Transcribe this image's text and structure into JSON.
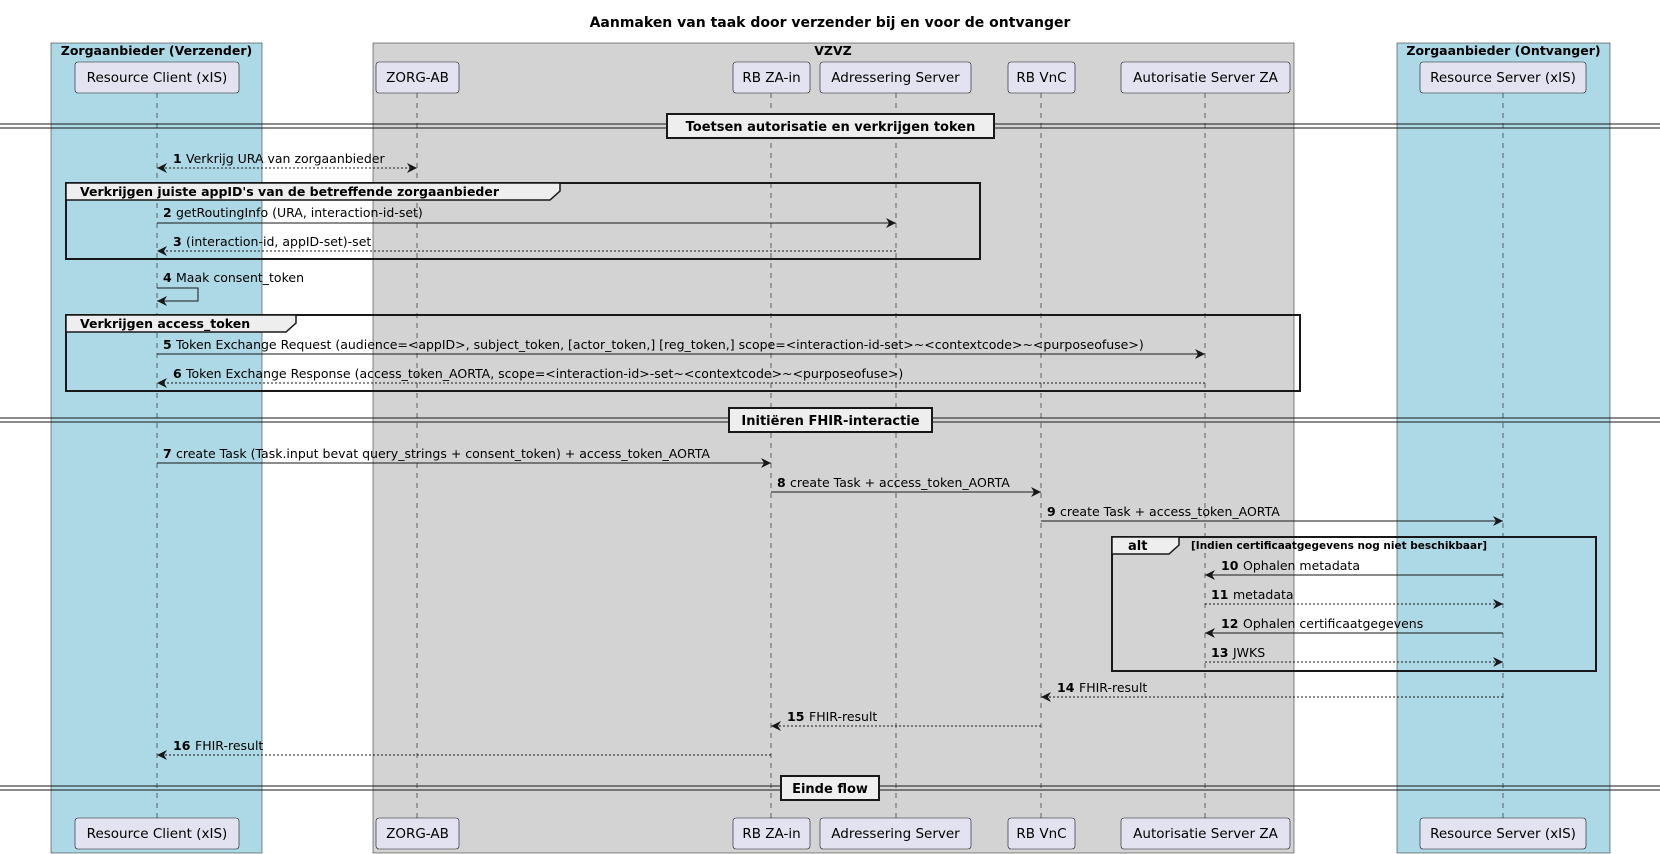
{
  "title": "Aanmaken van taak door verzender bij en voor de ontvanger",
  "boxes": [
    {
      "id": "verzender",
      "title": "Zorgaanbieder (Verzender)",
      "color": "#add8e6"
    },
    {
      "id": "vzvz",
      "title": "VZVZ",
      "color": "#d3d3d3"
    },
    {
      "id": "ontvanger",
      "title": "Zorgaanbieder (Ontvanger)",
      "color": "#add8e6"
    }
  ],
  "participants": [
    {
      "id": "rc",
      "label": "Resource Client (xIS)"
    },
    {
      "id": "zorgab",
      "label": "ZORG-AB"
    },
    {
      "id": "rbza",
      "label": "RB ZA-in"
    },
    {
      "id": "adr",
      "label": "Adressering Server"
    },
    {
      "id": "rbvnc",
      "label": "RB VnC"
    },
    {
      "id": "auth",
      "label": "Autorisatie Server ZA"
    },
    {
      "id": "rs",
      "label": "Resource Server (xIS)"
    }
  ],
  "dividers": [
    {
      "id": "d1",
      "label": "Toetsen autorisatie en verkrijgen token"
    },
    {
      "id": "d2",
      "label": "Initiëren FHIR-interactie"
    },
    {
      "id": "d3",
      "label": "Einde flow"
    }
  ],
  "groups": [
    {
      "id": "g1",
      "label": "Verkrijgen juiste appID's van de betreffende zorgaanbieder"
    },
    {
      "id": "g2",
      "label": "Verkrijgen access_token"
    },
    {
      "id": "g3",
      "keyword": "alt",
      "label": "[Indien certificaatgegevens nog niet beschikbaar]"
    }
  ],
  "messages": [
    {
      "num": "1",
      "from": "rc",
      "to": "zorgab",
      "label": "Verkrijg URA van zorgaanbieder",
      "style": "bidir-dashed"
    },
    {
      "num": "2",
      "from": "rc",
      "to": "adr",
      "label": "getRoutingInfo (URA, interaction-id-set)",
      "style": "solid"
    },
    {
      "num": "3",
      "from": "adr",
      "to": "rc",
      "label": "(interaction-id, appID-set)-set",
      "style": "dashed"
    },
    {
      "num": "4",
      "from": "rc",
      "to": "rc",
      "label": "Maak consent_token",
      "style": "self"
    },
    {
      "num": "5",
      "from": "rc",
      "to": "auth",
      "label": "Token Exchange Request (audience=<appID>, subject_token, [actor_token,] [reg_token,] scope=<interaction-id-set>~<contextcode>~<purposeofuse>)",
      "style": "solid"
    },
    {
      "num": "6",
      "from": "auth",
      "to": "rc",
      "label": "Token Exchange Response (access_token_AORTA, scope=<interaction-id>-set~<contextcode>~<purposeofuse>)",
      "style": "dashed"
    },
    {
      "num": "7",
      "from": "rc",
      "to": "rbza",
      "label": "create Task (Task.input bevat query_strings + consent_token) + access_token_AORTA",
      "style": "solid"
    },
    {
      "num": "8",
      "from": "rbza",
      "to": "rbvnc",
      "label": "create Task + access_token_AORTA",
      "style": "solid"
    },
    {
      "num": "9",
      "from": "rbvnc",
      "to": "rs",
      "label": "create Task + access_token_AORTA",
      "style": "solid"
    },
    {
      "num": "10",
      "from": "rs",
      "to": "auth",
      "label": "Ophalen metadata",
      "style": "solid"
    },
    {
      "num": "11",
      "from": "auth",
      "to": "rs",
      "label": "metadata",
      "style": "dashed"
    },
    {
      "num": "12",
      "from": "rs",
      "to": "auth",
      "label": "Ophalen certificaatgegevens",
      "style": "solid"
    },
    {
      "num": "13",
      "from": "auth",
      "to": "rs",
      "label": "JWKS",
      "style": "dashed"
    },
    {
      "num": "14",
      "from": "rs",
      "to": "rbvnc",
      "label": "FHIR-result",
      "style": "dashed"
    },
    {
      "num": "15",
      "from": "rbvnc",
      "to": "rbza",
      "label": "FHIR-result",
      "style": "dashed"
    },
    {
      "num": "16",
      "from": "rbza",
      "to": "rc",
      "label": "FHIR-result",
      "style": "dashed"
    }
  ]
}
